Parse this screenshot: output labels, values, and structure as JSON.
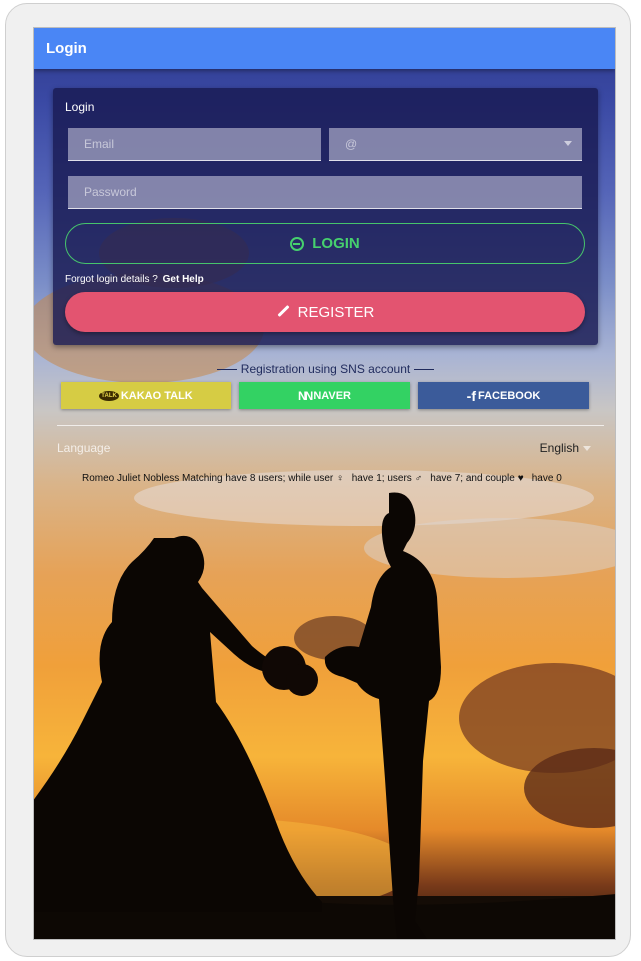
{
  "appbar": {
    "title": "Login"
  },
  "card": {
    "title": "Login",
    "email_placeholder": "Email",
    "domain_select_value": "@",
    "password_placeholder": "Password",
    "login_label": "LOGIN",
    "forgot_text": "Forgot login details ?",
    "get_help_label": "Get Help",
    "register_label": "REGISTER"
  },
  "sns": {
    "label": "Registration using SNS account",
    "kakao_icon_text": "TALK",
    "kakao_label": "KAKAO TALK",
    "naver_label": "NAVER",
    "facebook_label": "FACEBOOK"
  },
  "language": {
    "label": "Language",
    "value": "English"
  },
  "stats": {
    "text": "Romeo Juliet Nobless Matching have 8 users; while user",
    "female_symbol": "♀",
    "female_text": "have 1; users",
    "male_symbol": "♂",
    "male_text": "have 7; and couple",
    "couple_symbol": "♥",
    "couple_text": "have 0"
  },
  "icons": {
    "login": "login-icon",
    "register": "brush-icon",
    "kakao": "kakao-talk-icon",
    "naver": "naver-icon",
    "facebook": "facebook-icon"
  },
  "colors": {
    "appbar": "#4a86f5",
    "login_green": "#46d06e",
    "register_pink": "#e35470",
    "kakao": "#d6cc44",
    "naver": "#33d263",
    "facebook": "#3b5b9a"
  }
}
